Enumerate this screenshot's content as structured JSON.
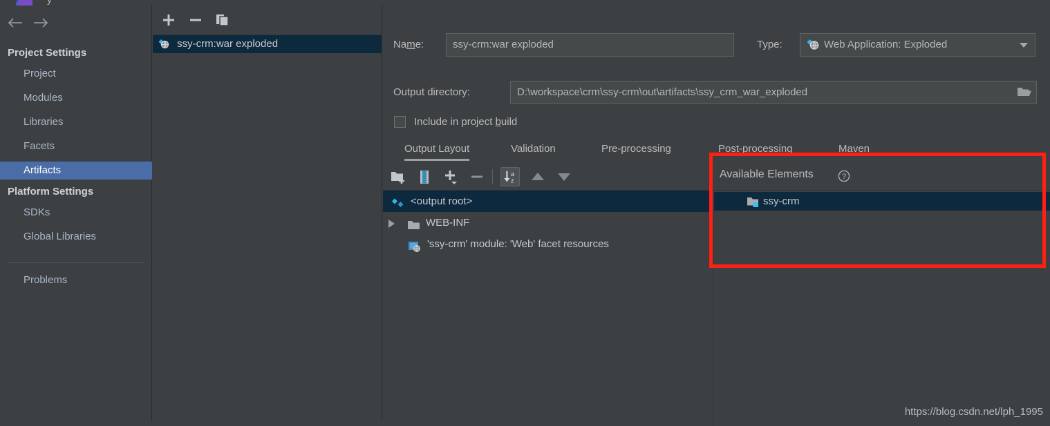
{
  "window": {
    "title_fragment": "y",
    "logo": "intellij-logo"
  },
  "sidebar": {
    "nav": {
      "back_icon": "arrow-left-icon",
      "forward_icon": "arrow-right-icon"
    },
    "groups": [
      {
        "header": "Project Settings",
        "items": [
          {
            "label": "Project",
            "selected": false
          },
          {
            "label": "Modules",
            "selected": false
          },
          {
            "label": "Libraries",
            "selected": false
          },
          {
            "label": "Facets",
            "selected": false
          },
          {
            "label": "Artifacts",
            "selected": true
          }
        ]
      },
      {
        "header": "Platform Settings",
        "items": [
          {
            "label": "SDKs",
            "selected": false
          },
          {
            "label": "Global Libraries",
            "selected": false
          }
        ]
      }
    ],
    "problems_label": "Problems"
  },
  "artifact_panel": {
    "toolbar": [
      {
        "name": "add-artifact-button",
        "glyph": "plus-icon"
      },
      {
        "name": "remove-artifact-button",
        "glyph": "minus-icon"
      },
      {
        "name": "copy-artifact-button",
        "glyph": "copy-icon"
      }
    ],
    "items": [
      {
        "label": "ssy-crm:war exploded",
        "icon": "web-application-exploded-icon",
        "selected": true
      }
    ]
  },
  "detail": {
    "name_label": "Na",
    "name_label_mnemonic": "m",
    "name_label_tail": "e:",
    "name_value": "ssy-crm:war exploded",
    "type_label": "Type:",
    "type_value": "Web Application: Exploded",
    "type_icon": "web-application-exploded-icon",
    "type_arrow_icon": "chevron-down-icon",
    "outdir_label": "Output directory:",
    "outdir_value": "D:\\workspace\\crm\\ssy-crm\\out\\artifacts\\ssy_crm_war_exploded",
    "outdir_browse_icon": "folder-open-icon",
    "include_label_head": "Include in project ",
    "include_label_mnemonic": "b",
    "include_label_tail": "uild",
    "include_checked": false,
    "tabs": [
      {
        "label": "Output Layout",
        "active": true
      },
      {
        "label": "Validation",
        "active": false
      },
      {
        "label": "Pre-processing",
        "active": false
      },
      {
        "label": "Post-processing",
        "active": false
      },
      {
        "label": "Maven",
        "active": false
      }
    ],
    "layout_toolbar": [
      {
        "name": "create-directory-button",
        "glyph": "new-folder-icon",
        "toggled": false
      },
      {
        "name": "create-archive-button",
        "glyph": "archive-icon",
        "toggled": false
      },
      {
        "name": "add-element-button",
        "glyph": "plus-dropdown-icon",
        "toggled": false
      },
      {
        "name": "remove-element-button",
        "glyph": "minus-icon",
        "toggled": false
      },
      {
        "name": "sort-alphabetically-button",
        "glyph": "sort-az-icon",
        "toggled": true
      },
      {
        "name": "move-up-button",
        "glyph": "arrow-up-icon",
        "toggled": false
      },
      {
        "name": "move-down-button",
        "glyph": "arrow-down-icon",
        "toggled": false
      }
    ],
    "tree": [
      {
        "label": "<output root>",
        "icon": "output-root-icon",
        "selected": true,
        "indent": 0,
        "expander": false
      },
      {
        "label": "WEB-INF",
        "icon": "folder-icon",
        "selected": false,
        "indent": 1,
        "expander": true
      },
      {
        "label": "'ssy-crm' module: 'Web' facet resources",
        "icon": "web-facet-icon",
        "selected": false,
        "indent": 1,
        "expander": false
      }
    ]
  },
  "available_elements": {
    "title": "Available Elements",
    "help_icon": "help-circle-icon",
    "items": [
      {
        "label": "ssy-crm",
        "icon": "module-folder-icon",
        "selected": true
      }
    ]
  },
  "annotation": {
    "color": "#fe1f15",
    "shape": "rectangle-highlight"
  },
  "watermark": "https://blog.csdn.net/lph_1995"
}
